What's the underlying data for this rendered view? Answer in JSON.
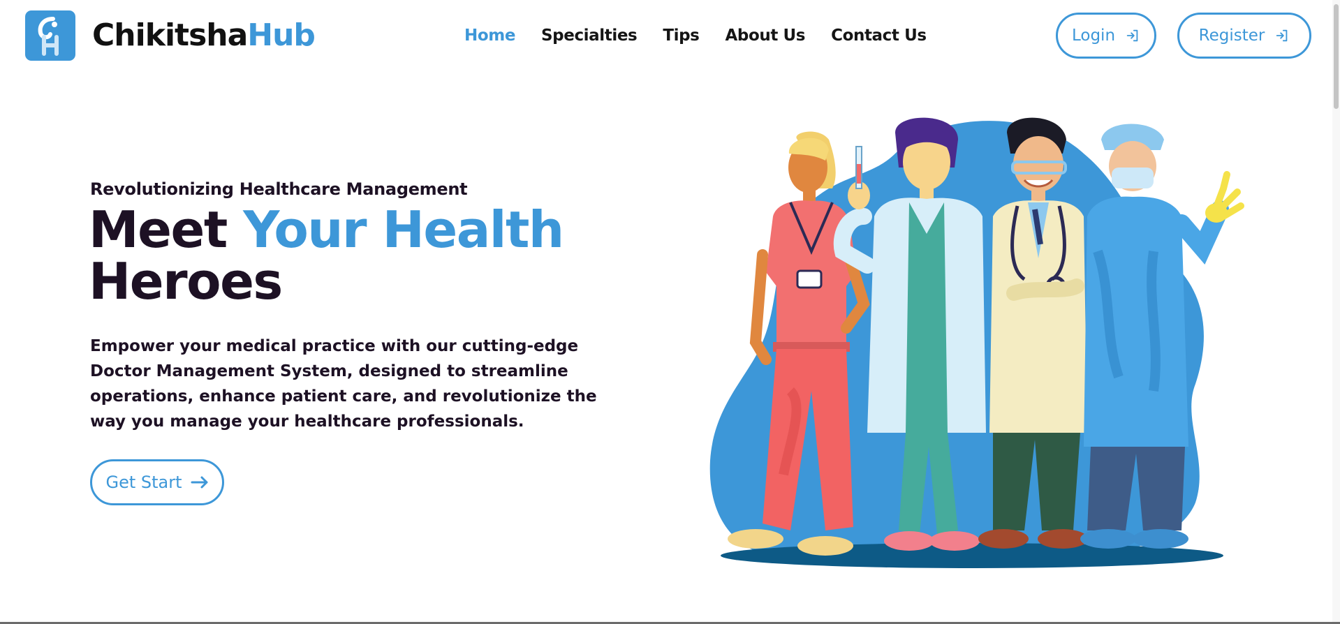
{
  "brand": {
    "name_first": "Chikitsha",
    "name_second": "Hub",
    "logo_icon": "ch-monogram-logo",
    "accent_color": "#3d97d8"
  },
  "nav": {
    "items": [
      {
        "label": "Home",
        "active": true
      },
      {
        "label": "Specialties",
        "active": false
      },
      {
        "label": "Tips",
        "active": false
      },
      {
        "label": "About Us",
        "active": false
      },
      {
        "label": "Contact Us",
        "active": false
      }
    ]
  },
  "auth": {
    "login_label": "Login",
    "login_icon": "sign-in-icon",
    "register_label": "Register",
    "register_icon": "sign-in-icon"
  },
  "hero": {
    "eyebrow": "Revolutionizing Healthcare Management",
    "headline_part1": "Meet ",
    "headline_accent": "Your Health",
    "headline_part2": "Heroes",
    "description": "Empower your medical practice with our cutting-edge Doctor Management System, designed to streamline operations, enhance patient care, and revolutionize the way you manage your healthcare professionals.",
    "cta_label": "Get Start",
    "cta_icon": "arrow-right-icon",
    "illustration": "four-healthcare-workers-illustration"
  }
}
